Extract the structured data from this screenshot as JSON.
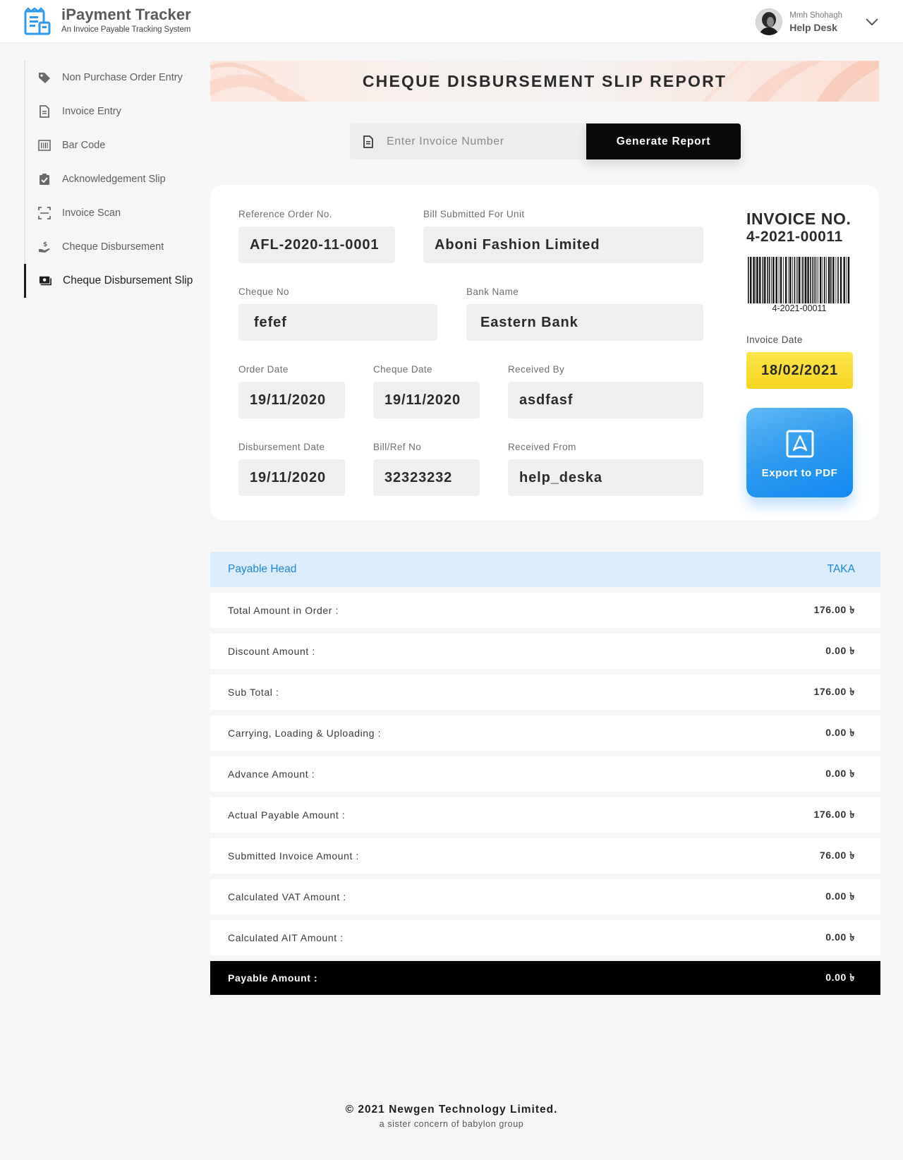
{
  "app": {
    "title": "iPayment Tracker",
    "subtitle": "An Invoice Payable Tracking System"
  },
  "user": {
    "name": "Mmh Shohagh",
    "role": "Help Desk"
  },
  "sidebar": {
    "items": [
      {
        "label": "Non Purchase Order Entry",
        "icon": "tag-icon"
      },
      {
        "label": "Invoice Entry",
        "icon": "document-icon"
      },
      {
        "label": "Bar Code",
        "icon": "barcode-icon"
      },
      {
        "label": "Acknowledgement Slip",
        "icon": "clipboard-check-icon"
      },
      {
        "label": "Invoice Scan",
        "icon": "scan-icon"
      },
      {
        "label": "Cheque Disbursement",
        "icon": "hand-dollar-icon"
      },
      {
        "label": "Cheque Disbursement Slip",
        "icon": "money-icon",
        "active": true
      }
    ]
  },
  "page": {
    "title": "CHEQUE DISBURSEMENT SLIP REPORT"
  },
  "search": {
    "placeholder": "Enter Invoice Number",
    "value": "",
    "button_label": "Generate Report"
  },
  "details": {
    "reference_order": {
      "label": "Reference Order No.",
      "value": "AFL-2020-11-0001"
    },
    "bill_unit": {
      "label": "Bill Submitted For Unit",
      "value": "Aboni Fashion Limited"
    },
    "cheque_no": {
      "label": "Cheque No",
      "value": "fefef"
    },
    "bank_name": {
      "label": "Bank Name",
      "value": "Eastern Bank"
    },
    "order_date": {
      "label": "Order Date",
      "value": "19/11/2020"
    },
    "cheque_date": {
      "label": "Cheque Date",
      "value": "19/11/2020"
    },
    "received_by": {
      "label": "Received By",
      "value": "asdfasf"
    },
    "disbursement_date": {
      "label": "Disbursement Date",
      "value": "19/11/2020"
    },
    "bill_ref": {
      "label": "Bill/Ref No",
      "value": "32323232"
    },
    "received_from": {
      "label": "Received From",
      "value": "help_deska"
    }
  },
  "invoice": {
    "title": "INVOICE NO.",
    "number": "4-2021-00011",
    "barcode_text": "4-2021-00011",
    "date_label": "Invoice Date",
    "date": "18/02/2021",
    "export_label": "Export to PDF"
  },
  "table": {
    "head_label": "Payable Head",
    "currency_label": "TAKA",
    "rows": [
      {
        "label": "Total Amount in Order :",
        "amount": "176.00 ৳"
      },
      {
        "label": "Discount Amount :",
        "amount": "0.00 ৳"
      },
      {
        "label": "Sub Total :",
        "amount": "176.00 ৳"
      },
      {
        "label": "Carrying, Loading & Uploading :",
        "amount": "0.00 ৳"
      },
      {
        "label": "Advance Amount :",
        "amount": "0.00 ৳"
      },
      {
        "label": "Actual Payable Amount :",
        "amount": "176.00 ৳"
      },
      {
        "label": "Submitted Invoice Amount :",
        "amount": "76.00 ৳"
      },
      {
        "label": "Calculated VAT Amount :",
        "amount": "0.00 ৳"
      },
      {
        "label": "Calculated AIT Amount :",
        "amount": "0.00 ৳"
      }
    ],
    "total": {
      "label": "Payable Amount :",
      "amount": "0.00 ৳"
    }
  },
  "footer": {
    "copyright": "© 2021 Newgen Technology Limited.",
    "tagline": "a sister concern of babylon group"
  },
  "colors": {
    "accent_blue": "#2d9af0",
    "date_yellow": "#f6d31f",
    "table_head_bg": "#dbedfb",
    "table_head_text": "#1c86d8"
  }
}
